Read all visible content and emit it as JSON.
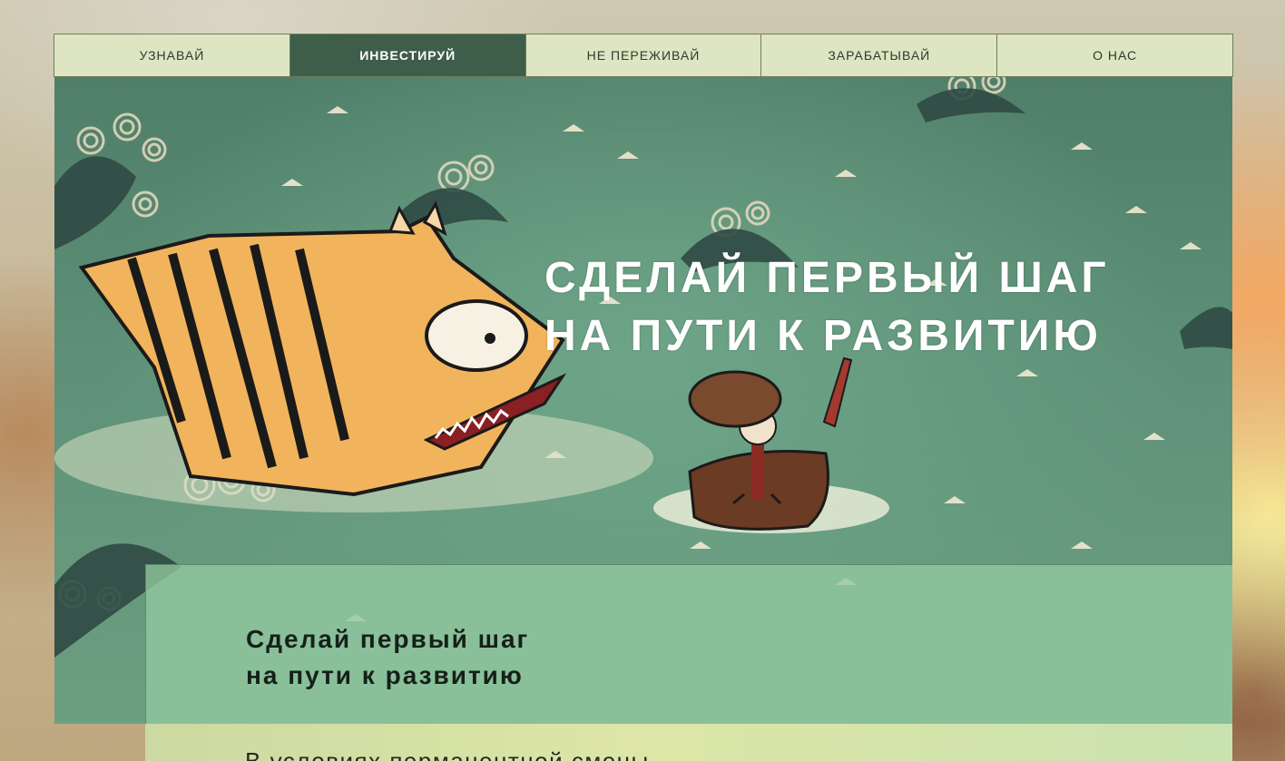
{
  "nav": {
    "items": [
      {
        "label": "УЗНАВАЙ"
      },
      {
        "label": "ИНВЕСТИРУЙ"
      },
      {
        "label": "НЕ ПЕРЕЖИВАЙ"
      },
      {
        "label": "ЗАРАБАТЫВАЙ"
      },
      {
        "label": "О НАС"
      }
    ],
    "active_label": "ИНВЕСТИРУЙ"
  },
  "hero": {
    "title_line1": "СДЕЛАЙ ПЕРВЫЙ ШАГ",
    "title_line2": "НА ПУТИ К РАЗВИТИЮ"
  },
  "card": {
    "title_line1": "Сделай первый шаг",
    "title_line2": "на пути к развитию"
  },
  "lower": {
    "text": "В условиях перманентной смены"
  },
  "colors": {
    "nav_bg": "#dde5c2",
    "nav_active_bg": "#3f5e4a",
    "sea": "#5e9178",
    "card_bg": "#92c9a0"
  }
}
